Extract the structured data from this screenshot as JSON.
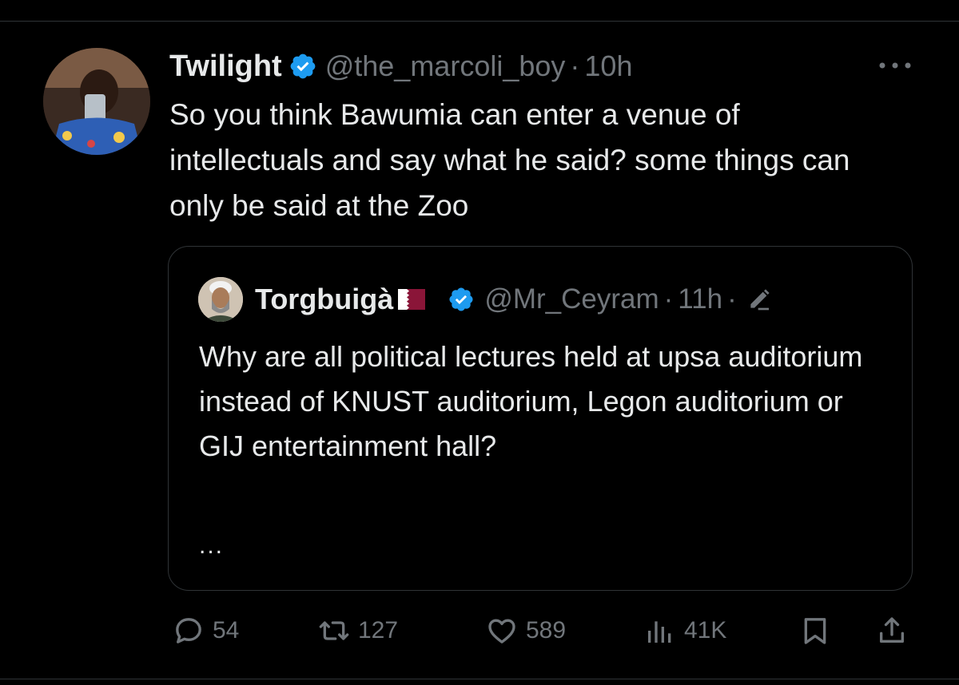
{
  "tweet": {
    "author_name": "Twilight",
    "handle": "@the_marcoli_boy",
    "separator": "·",
    "time": "10h",
    "text": "So you think Bawumia can enter a venue of intellectuals and say what he said? some things can only be said at the Zoo"
  },
  "quote": {
    "author_name": "Torgbuigà",
    "handle": "@Mr_Ceyram",
    "separator": "·",
    "time": "11h",
    "time_separator": "·",
    "text": "Why are all political lectures held at upsa auditorium instead of KNUST auditorium, Legon auditorium or GIJ entertainment hall?",
    "truncation": "..."
  },
  "actions": {
    "replies": "54",
    "reposts": "127",
    "likes": "589",
    "views": "41K"
  },
  "colors": {
    "background": "#000000",
    "text": "#e7e9ea",
    "muted": "#71767b",
    "verified": "#1d9bf0",
    "border": "#2f3336",
    "flag": "#8a1538"
  },
  "icons": [
    "verified-badge-icon",
    "more-icon",
    "flag-icon",
    "edit-icon",
    "reply-icon",
    "repost-icon",
    "like-icon",
    "views-icon",
    "bookmark-icon",
    "share-icon"
  ]
}
